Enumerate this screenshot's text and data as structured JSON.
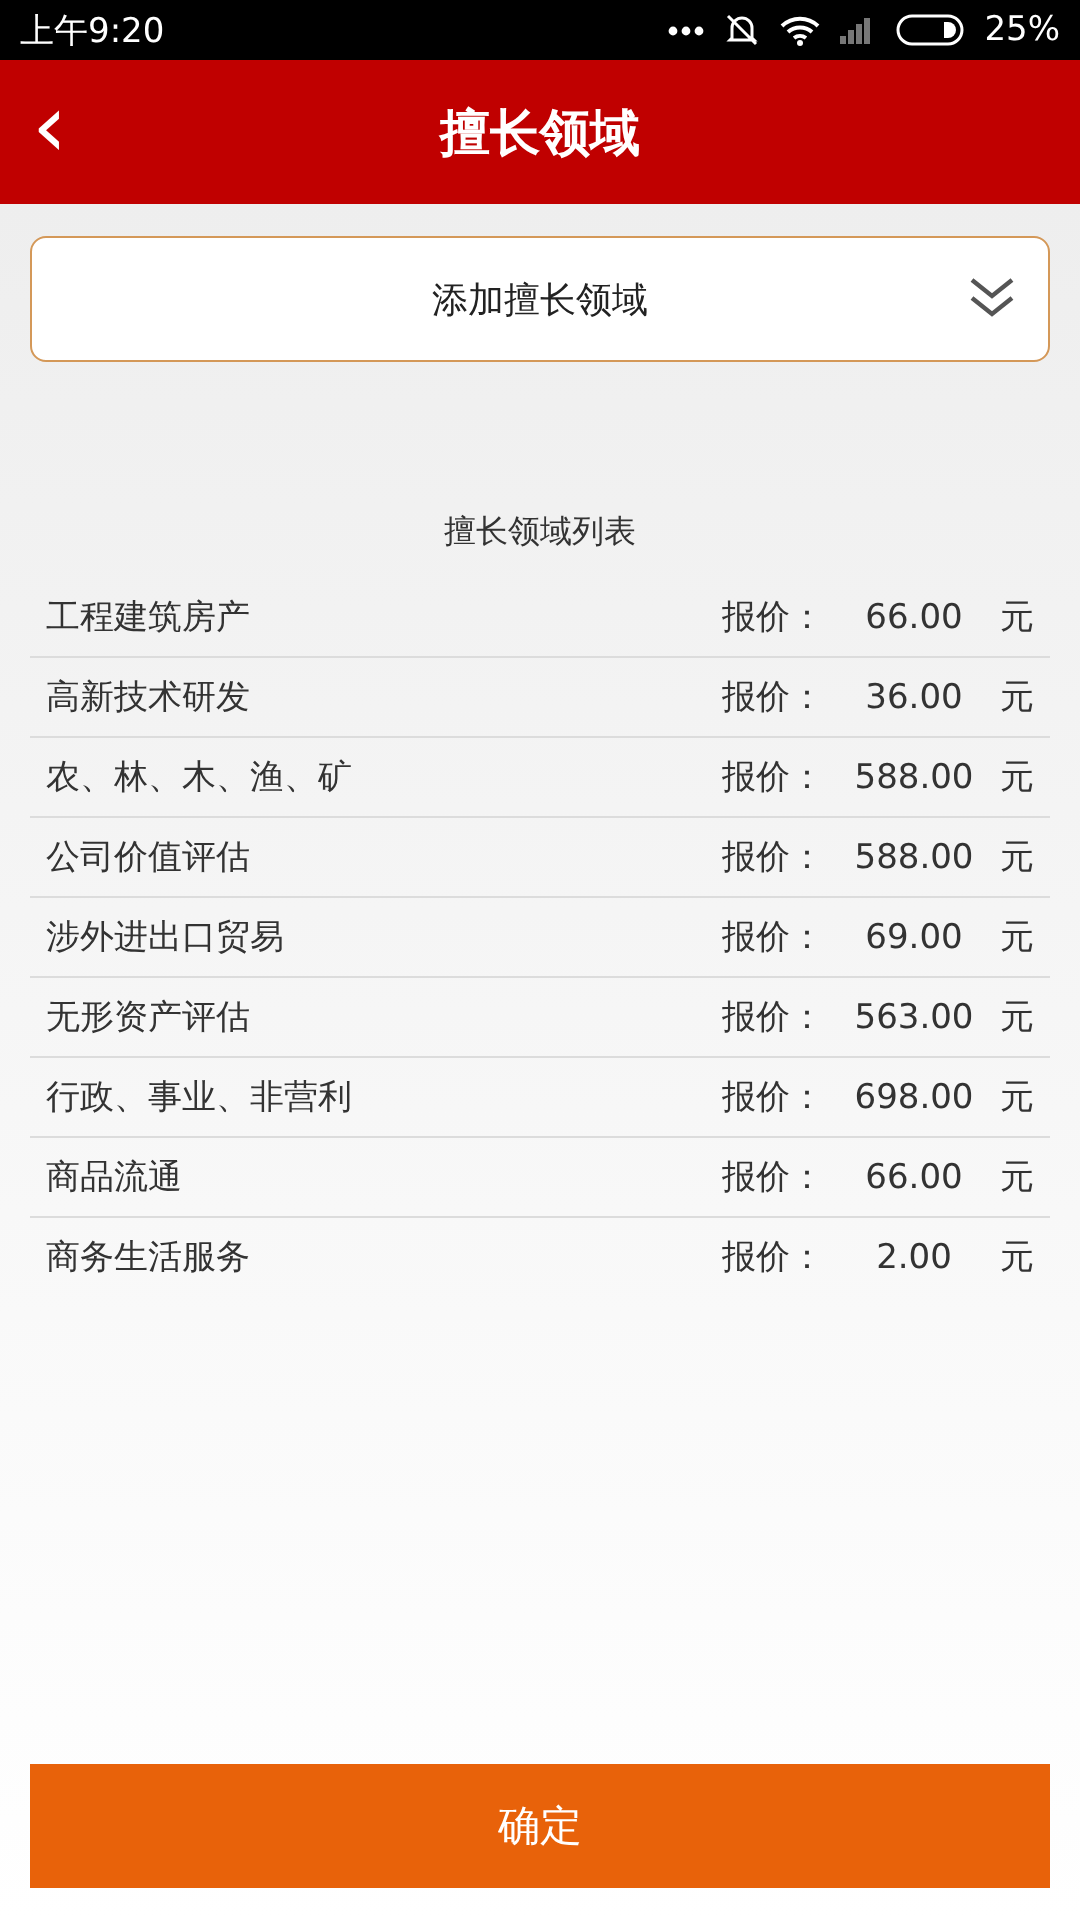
{
  "status_bar": {
    "time": "上午9:20",
    "battery": "25%"
  },
  "header": {
    "back": "‹",
    "title": "擅长领域"
  },
  "dropdown": {
    "label": "添加擅长领域"
  },
  "list": {
    "title": "擅长领域列表",
    "rows": [
      {
        "name": "工程建筑房产",
        "price_label": "报价：",
        "price": "66.00",
        "unit": "元"
      },
      {
        "name": "高新技术研发",
        "price_label": "报价：",
        "price": "36.00",
        "unit": "元"
      },
      {
        "name": "农、林、木、渔、矿",
        "price_label": "报价：",
        "price": "588.00",
        "unit": "元"
      },
      {
        "name": "公司价值评估",
        "price_label": "报价：",
        "price": "588.00",
        "unit": "元"
      },
      {
        "name": "涉外进出口贸易",
        "price_label": "报价：",
        "price": "69.00",
        "unit": "元"
      },
      {
        "name": "无形资产评估",
        "price_label": "报价：",
        "price": "563.00",
        "unit": "元"
      },
      {
        "name": "行政、事业、非营利",
        "price_label": "报价：",
        "price": "698.00",
        "unit": "元"
      },
      {
        "name": "商品流通",
        "price_label": "报价：",
        "price": "66.00",
        "unit": "元"
      },
      {
        "name": "商务生活服务",
        "price_label": "报价：",
        "price": "2.00",
        "unit": "元"
      }
    ]
  },
  "confirm_button": "确定"
}
